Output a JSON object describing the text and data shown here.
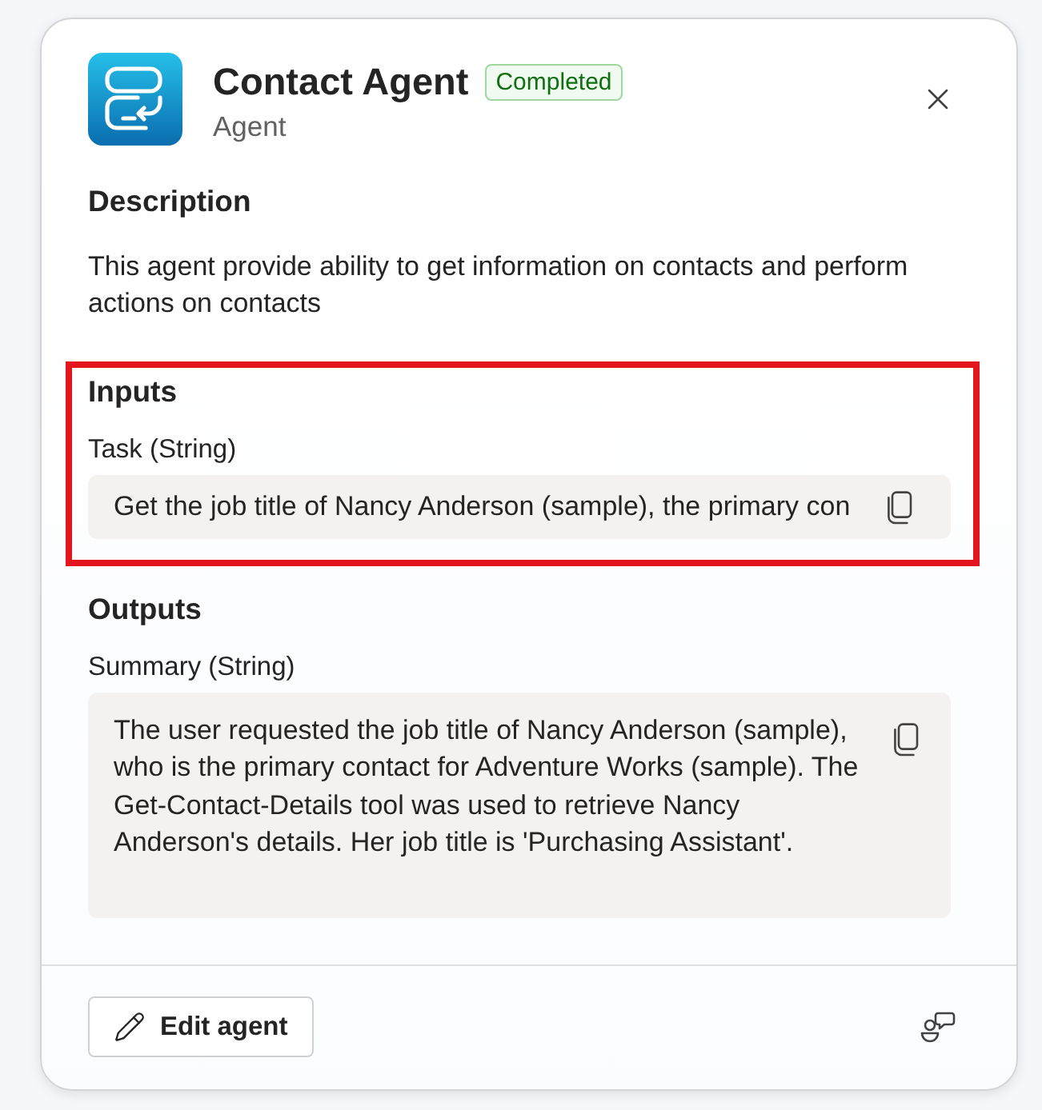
{
  "header": {
    "title": "Contact Agent",
    "status": {
      "label": "Completed",
      "kind": "success"
    },
    "subtitle": "Agent"
  },
  "description": {
    "heading": "Description",
    "text": "This agent provide ability to get information on contacts and perform actions on contacts"
  },
  "inputs": {
    "heading": "Inputs",
    "highlighted": true,
    "fields": [
      {
        "label": "Task (String)",
        "kind": "line",
        "value": "Get the job title of Nancy Anderson (sample), the primary con"
      }
    ]
  },
  "outputs": {
    "heading": "Outputs",
    "fields": [
      {
        "label": "Summary (String)",
        "kind": "block",
        "value": "The user requested the job title of Nancy Anderson (sample), who is the primary contact for Adventure Works (sample). The Get-Contact-Details tool was used to retrieve Nancy Anderson's details. Her job title is 'Purchasing Assistant'."
      }
    ]
  },
  "footer": {
    "buttons": [
      {
        "label": "Edit agent"
      }
    ]
  }
}
